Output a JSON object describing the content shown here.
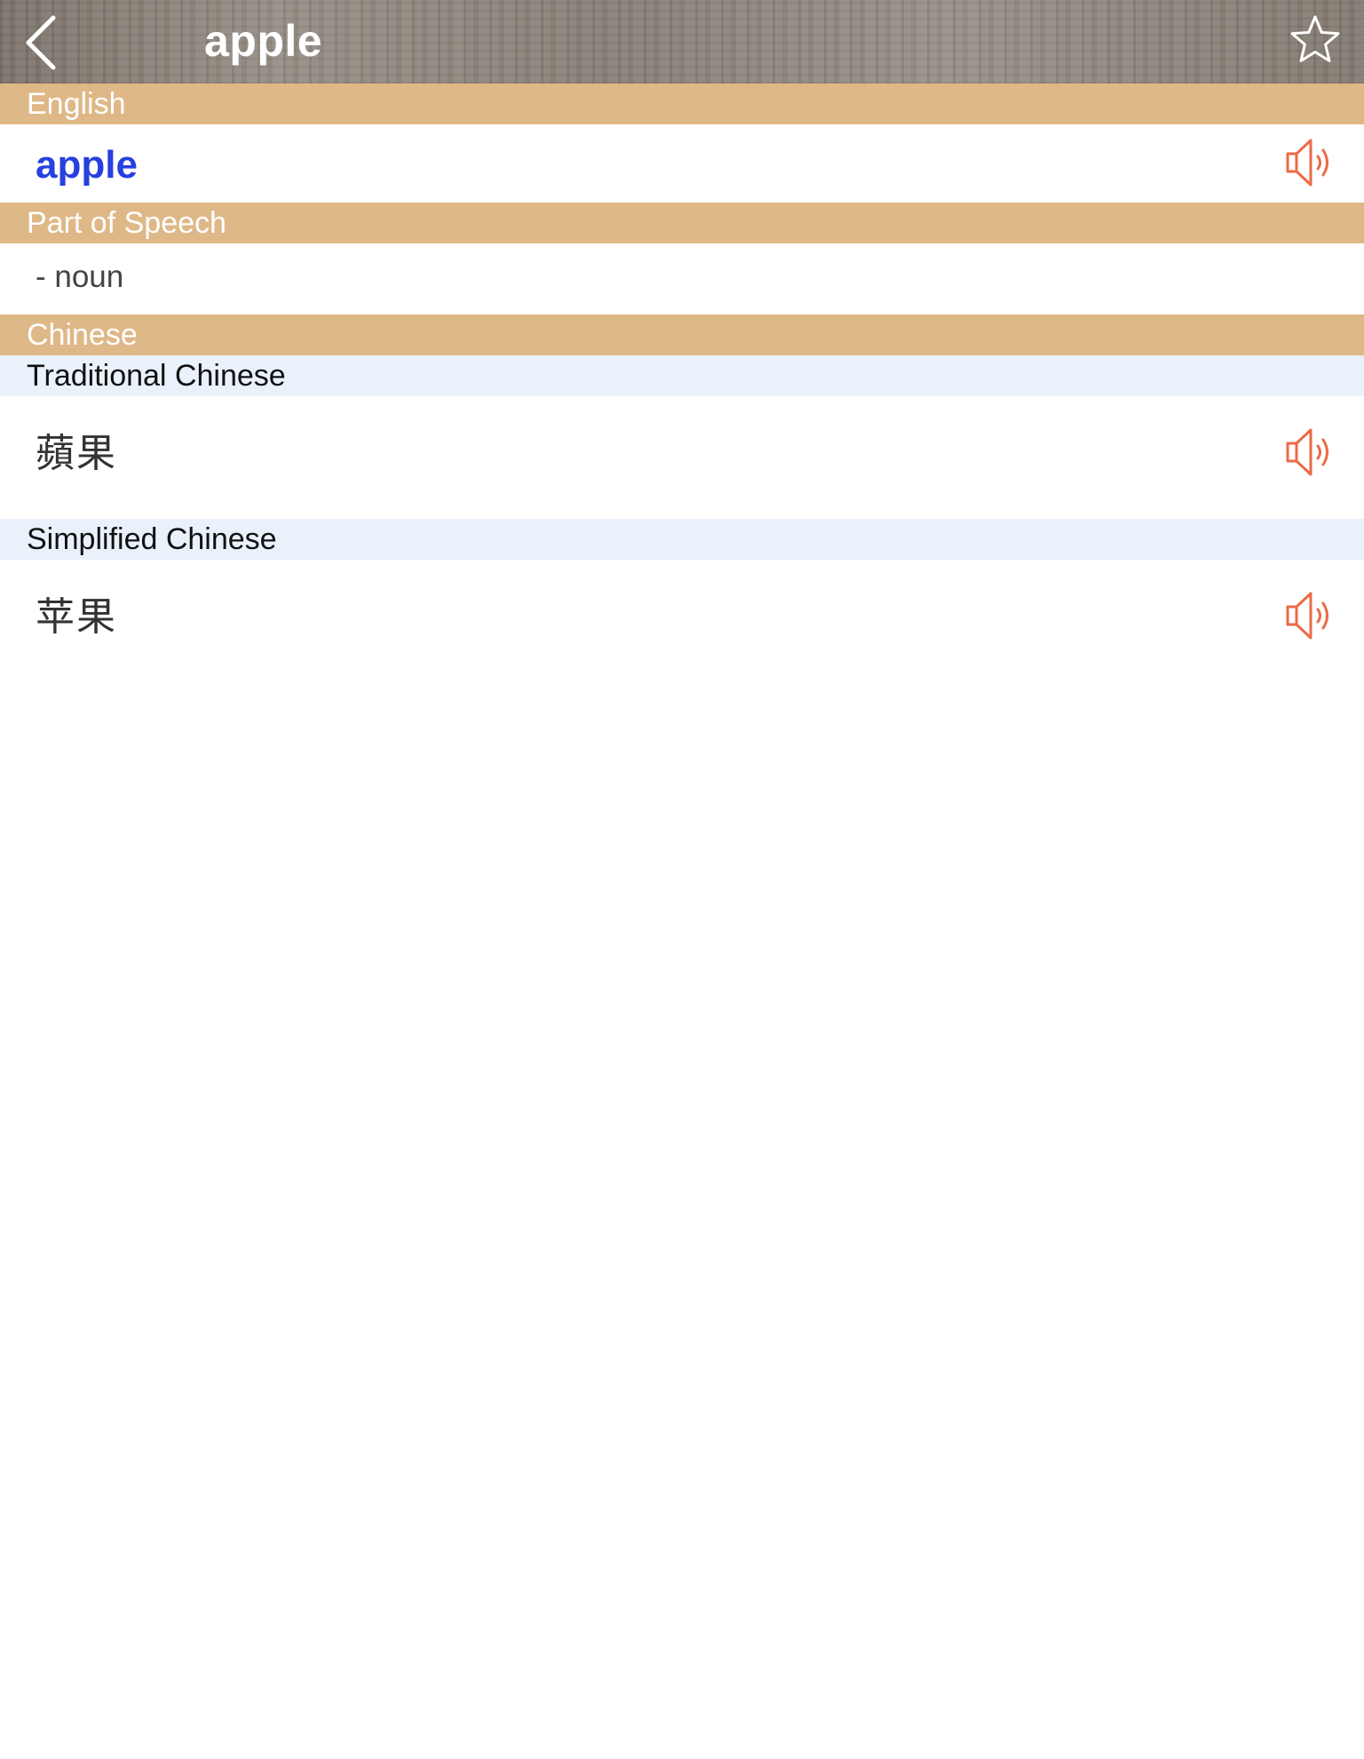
{
  "nav": {
    "title": "apple",
    "back_icon": "chevron-left-icon",
    "favorite_icon": "star-outline-icon"
  },
  "sections": {
    "english": {
      "header": "English",
      "word": "apple",
      "audio_icon": "speaker-icon"
    },
    "part_of_speech": {
      "header": "Part of Speech",
      "value": "- noun"
    },
    "chinese": {
      "header": "Chinese",
      "traditional": {
        "label": "Traditional Chinese",
        "value": "蘋果",
        "audio_icon": "speaker-icon"
      },
      "simplified": {
        "label": "Simplified Chinese",
        "value": "苹果",
        "audio_icon": "speaker-icon"
      }
    }
  },
  "colors": {
    "section_header_bg": "#dfb887",
    "sub_header_bg": "#e9f1fb",
    "word_color": "#2740e0",
    "speaker_color": "#ec6a47"
  }
}
